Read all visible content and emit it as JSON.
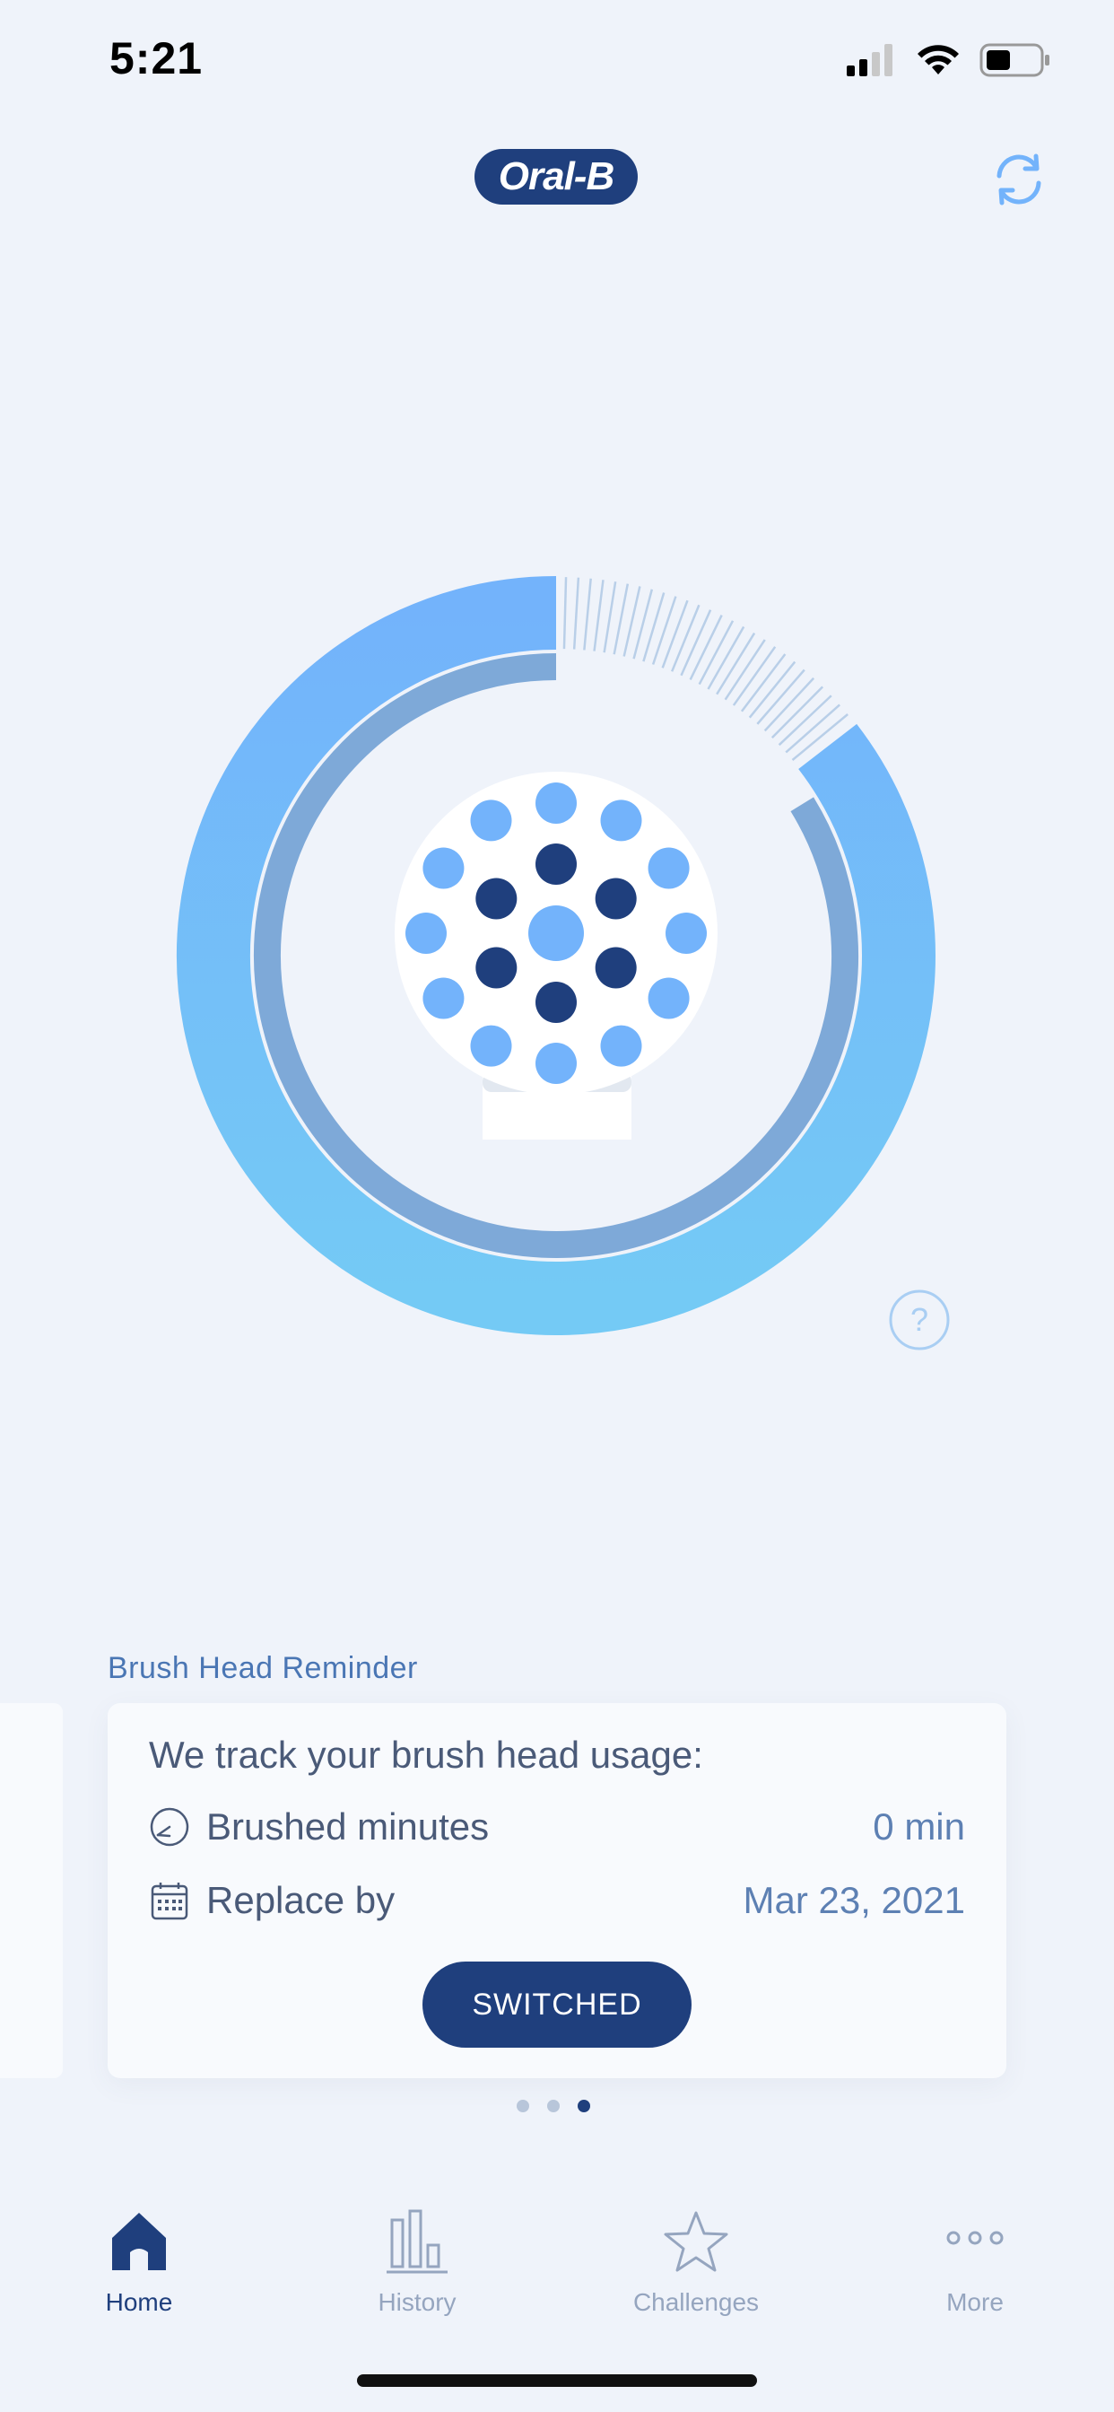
{
  "status_bar": {
    "time": "5:21"
  },
  "header": {
    "logo_text": "Oral-B",
    "sync_icon": "sync-icon"
  },
  "ring": {
    "usage_fraction": 0.14,
    "colors": {
      "outer_top": "#73b3fb",
      "outer_bottom": "#74caf5",
      "inner": "#7ea9d8",
      "hatch": "#b9cfe8"
    }
  },
  "reminder": {
    "section_label": "Brush Head Reminder",
    "card_title": "We track your brush head usage:",
    "rows": [
      {
        "icon": "clock-icon",
        "label": "Brushed minutes",
        "value": "0 min"
      },
      {
        "icon": "calendar-icon",
        "label": "Replace by",
        "value": "Mar 23, 2021"
      }
    ],
    "button_label": "SWITCHED"
  },
  "pager": {
    "count": 3,
    "active_index": 2
  },
  "tabs": [
    {
      "label": "Home",
      "icon": "home-icon",
      "active": true
    },
    {
      "label": "History",
      "icon": "bar-chart-icon",
      "active": false
    },
    {
      "label": "Challenges",
      "icon": "star-icon",
      "active": false
    },
    {
      "label": "More",
      "icon": "more-dots-icon",
      "active": false
    }
  ],
  "colors": {
    "brand": "#1f3f7d",
    "accent": "#73b3fb",
    "background": "#eff3fa"
  }
}
